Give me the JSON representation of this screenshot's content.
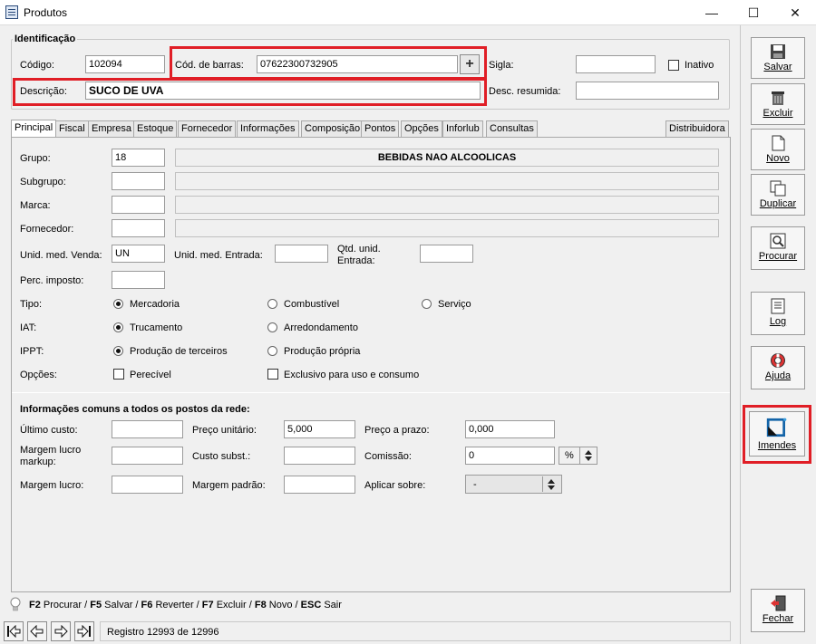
{
  "window": {
    "title": "Produtos",
    "minimize": "—",
    "maximize": "☐",
    "close": "✕"
  },
  "identificacao": {
    "title": "Identificação",
    "codigo_label": "Código:",
    "codigo_value": "102094",
    "barras_label": "Cód. de barras:",
    "barras_value": "07622300732905",
    "barras_add": "+",
    "sigla_label": "Sigla:",
    "sigla_value": "",
    "inativo_label": "Inativo",
    "descricao_label": "Descrição:",
    "descricao_value": "SUCO DE UVA",
    "desc_resumida_label": "Desc. resumida:",
    "desc_resumida_value": ""
  },
  "tabs": [
    "Principal",
    "Fiscal",
    "Empresa",
    "Estoque",
    "Fornecedor",
    "Informações",
    "Composição",
    "Pontos",
    "Opções",
    "Inforlub",
    "Consultas"
  ],
  "tab_right": "Distribuidora",
  "principal": {
    "grupo_label": "Grupo:",
    "grupo_value": "18",
    "grupo_desc": "BEBIDAS NAO ALCOOLICAS",
    "subgrupo_label": "Subgrupo:",
    "marca_label": "Marca:",
    "fornecedor_label": "Fornecedor:",
    "unid_venda_label": "Unid. med. Venda:",
    "unid_venda_value": "UN",
    "unid_entrada_label": "Unid. med. Entrada:",
    "qtd_unid_label_1": "Qtd. unid.",
    "qtd_unid_label_2": "Entrada:",
    "perc_imposto_label": "Perc. imposto:",
    "tipo_label": "Tipo:",
    "tipo_opts": [
      "Mercadoria",
      "Combustível",
      "Serviço"
    ],
    "iat_label": "IAT:",
    "iat_opts": [
      "Trucamento",
      "Arredondamento"
    ],
    "ippt_label": "IPPT:",
    "ippt_opts": [
      "Produção de terceiros",
      "Produção própria"
    ],
    "opcoes_label": "Opções:",
    "opcoes_opts": [
      "Perecível",
      "Exclusivo para uso e consumo"
    ]
  },
  "comuns": {
    "title": "Informações comuns a todos os postos da rede:",
    "ultimo_custo_label": "Último custo:",
    "preco_unit_label": "Preço unitário:",
    "preco_unit_value": "5,000",
    "preco_prazo_label": "Preço a prazo:",
    "preco_prazo_value": "0,000",
    "margem_markup_label_1": "Margem lucro",
    "margem_markup_label_2": "markup:",
    "custo_subst_label": "Custo subst.:",
    "comissao_label": "Comissão:",
    "comissao_value": "0",
    "comissao_unit": "%",
    "margem_lucro_label": "Margem lucro:",
    "margem_padrao_label": "Margem padrão:",
    "aplicar_label": "Aplicar sobre:",
    "aplicar_value": "-"
  },
  "side": [
    "Salvar",
    "Excluir",
    "Novo",
    "Duplicar",
    "Procurar",
    "Log",
    "Ajuda",
    "Imendes",
    "Fechar"
  ],
  "shortcuts": [
    {
      "key": "F2",
      "text": "Procurar /"
    },
    {
      "key": "F5",
      "text": "Salvar /"
    },
    {
      "key": "F6",
      "text": "Reverter /"
    },
    {
      "key": "F7",
      "text": "Excluir /"
    },
    {
      "key": "F8",
      "text": "Novo /"
    },
    {
      "key": "ESC",
      "text": "Sair"
    }
  ],
  "status": {
    "registro": "Registro 12993 de 12996"
  },
  "colors": {
    "highlight": "#e01e26"
  }
}
